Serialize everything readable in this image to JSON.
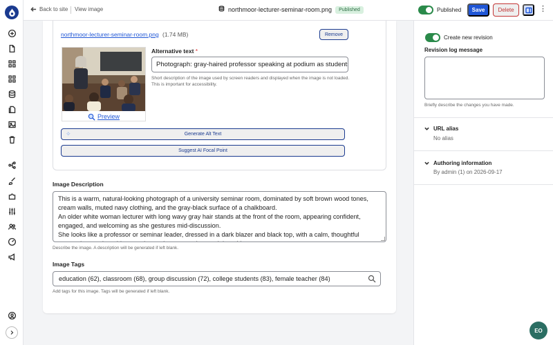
{
  "topbar": {
    "back_label": "Back to site",
    "view_label": "View image",
    "file_title": "northmoor-lecturer-seminar-room.png",
    "status_badge": "Published",
    "publish_label": "Published",
    "save_label": "Save",
    "delete_label": "Delete",
    "more_glyph": "⋮"
  },
  "image_field": {
    "file_name": "northmoor-lecturer-seminar-room.png",
    "file_size": "(1.74 MB)",
    "remove_label": "Remove",
    "preview_label": "Preview",
    "alt_label": "Alternative text",
    "alt_required_mark": "*",
    "alt_value": "Photograph: gray-haired professor speaking at podium as students listen",
    "alt_help": "Short description of the image used by screen readers and displayed when the image is not loaded. This is important for accessibility.",
    "generate_alt_label": "Generate Alt Text",
    "focal_point_label": "Suggest AI Focal Point"
  },
  "description": {
    "label": "Image Description",
    "text": "This is a warm, natural-looking photograph of a university seminar room, dominated by soft brown wood tones, cream walls, muted navy clothing, and the gray-black surface of a chalkboard.\nAn older white woman lecturer with long wavy gray hair stands at the front of the room, appearing confident, engaged, and welcoming as she gestures mid-discussion.\nShe looks like a professor or seminar leader, dressed in a dark blazer and black top, with a calm, thoughtful expression as she addresses the students seated around the table.",
    "help": "Describe the image. A description will be generated if left blank."
  },
  "tags": {
    "label": "Image Tags",
    "value": "education (62), classroom (68), group discussion (72), college students (83), female teacher (84)",
    "help": "Add tags for this image. Tags will be generated if left blank."
  },
  "sidebar": {
    "revision_label": "Create new revision",
    "log_label": "Revision log message",
    "log_help": "Briefly describe the changes you have made.",
    "url_alias_title": "URL alias",
    "url_alias_value": "No alias",
    "authoring_title": "Authoring information",
    "authoring_value": "By admin (1) on 2026-09-17"
  },
  "chat": {
    "label": "EO"
  },
  "colors": {
    "primary": "#1f56d6",
    "navy": "#1a3a8f",
    "success": "#2a8a4a",
    "danger": "#c23434",
    "chat": "#2b6e63"
  },
  "icons": {
    "rail": [
      "plus-circle-icon",
      "document-icon",
      "grid-icon",
      "grid-alt-icon",
      "database-icon",
      "files-icon",
      "image-icon",
      "trash-icon",
      "structure-icon",
      "brush-icon",
      "puzzle-icon",
      "sliders-icon",
      "people-icon",
      "gauge-icon",
      "megaphone-icon",
      "user-icon",
      "chevron-right-icon"
    ]
  }
}
